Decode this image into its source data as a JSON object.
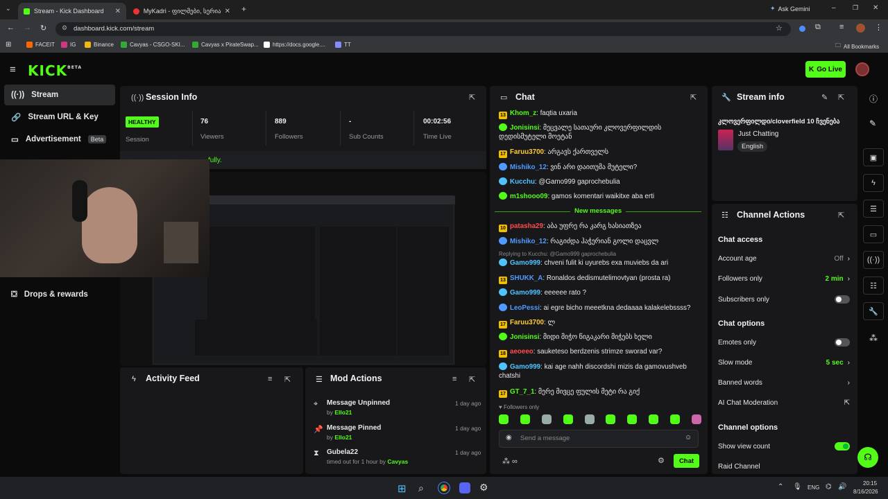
{
  "browser": {
    "tabs": [
      {
        "title": "Stream - Kick Dashboard"
      },
      {
        "title": "MyKadri - ფილმები, სერიალ"
      }
    ],
    "ask_gemini": "Ask Gemini",
    "url": "dashboard.kick.com/stream",
    "bookmarks": [
      "FACEIT",
      "IG",
      "Binance",
      "Cavyas - CSGO-SKI...",
      "Cavyas x PirateSwap...",
      "https://docs.google....",
      "TT"
    ],
    "all_bookmarks": "All Bookmarks"
  },
  "header": {
    "go_live": "Go Live"
  },
  "sidebar": {
    "items": [
      {
        "label": "Stream"
      },
      {
        "label": "Stream URL & Key"
      },
      {
        "label": "Advertisement"
      },
      {
        "label": "Drops & rewards"
      }
    ],
    "beta": "Beta"
  },
  "session": {
    "title": "Session Info",
    "status": "HEALTHY",
    "status_label": "Session",
    "stats": [
      {
        "value": "76",
        "label": "Viewers"
      },
      {
        "value": "889",
        "label": "Followers"
      },
      {
        "value": "-",
        "label": "Sub Counts"
      },
      {
        "value": "00:02:56",
        "label": "Time Live"
      }
    ],
    "notice": "fully."
  },
  "activity": {
    "title": "Activity Feed"
  },
  "mod_actions": {
    "title": "Mod Actions",
    "items": [
      {
        "action": "Message Unpinned",
        "by_prefix": "by",
        "by": "Ello21",
        "time": "1 day ago"
      },
      {
        "action": "Message Pinned",
        "by_prefix": "by",
        "by": "Ello21",
        "time": "1 day ago"
      },
      {
        "action": "Gubela22",
        "by_prefix": "timed out for 1 hour by",
        "by": "Cavyas",
        "time": "1 day ago"
      }
    ]
  },
  "chat": {
    "title": "Chat",
    "new_messages": "New messages",
    "replying": "Replying to Kucchu: @Gamo999 gaprochebulia",
    "followers_only": "Followers only",
    "input_placeholder": "Send a message",
    "send": "Chat",
    "colors": {
      "green": "#53fc18",
      "pink": "#ff4fd8",
      "blue": "#4f9bff",
      "red": "#ff4d4d"
    },
    "messages": [
      {
        "user": "Khom_z",
        "text": "faqtia uxaria",
        "color": "#53fc18",
        "badge": "13"
      },
      {
        "user": "Jonisinsi",
        "text": "მეცვალე სათაური კლოვერფილდის დედისმუტელი მოეტან",
        "color": "#53fc18",
        "badge": ""
      },
      {
        "user": "Faruu3700",
        "text": "არგავს ქართველს",
        "color": "#ffcc33",
        "badge": "17"
      },
      {
        "user": "Mishiko_12",
        "text": "ვინ არი დაითუმა მუტელი?",
        "color": "#4f9bff",
        "badge": ""
      },
      {
        "user": "Kucchu",
        "text": "@Gamo999 gaprochebulia",
        "color": "#4fc3ff",
        "badge": ""
      },
      {
        "user": "m1shooo09",
        "text": "gamos komentari waikitxe aba erti",
        "color": "#53fc18",
        "badge": ""
      },
      {
        "user": "patasha29",
        "text": "აბა უფრე რა კარგ ხასიათზეა",
        "color": "#ff4d4d",
        "badge": "10"
      },
      {
        "user": "Mishiko_12",
        "text": "რაგიძდა ჰაჭერიან გოლი დაცვლ",
        "color": "#4f9bff",
        "badge": ""
      },
      {
        "user": "Gamo999",
        "text": "chveni fulit ki uyurebs exa muviebs da ari",
        "color": "#4fc3ff",
        "badge": ""
      },
      {
        "user": "SHUKK_A",
        "text": "Ronaldos dedismutelimovtyan (prosta ra)",
        "color": "#4f9bff",
        "badge": "13"
      },
      {
        "user": "Gamo999",
        "text": "eeeeee rato ?",
        "color": "#4fc3ff",
        "badge": ""
      },
      {
        "user": "LeoPessi",
        "text": "ai egre bicho meeetkna dedaaaa kalakelebssss?",
        "color": "#4f9bff",
        "badge": ""
      },
      {
        "user": "Faruu3700",
        "text": "ლ",
        "color": "#ffcc33",
        "badge": "17"
      },
      {
        "user": "Jonisinsi",
        "text": "მიდი მიჭო წიგაკარი მიჭებს ხელი",
        "color": "#53fc18",
        "badge": ""
      },
      {
        "user": "aeoeeo",
        "text": "sauketeso berdzenis strimze sworad var?",
        "color": "#ff4d4d",
        "badge": "18"
      },
      {
        "user": "Gamo999",
        "text": "kai age nahh discordshi mizis da gamovushveb chatshi",
        "color": "#4fc3ff",
        "badge": ""
      },
      {
        "user": "GT_7_1",
        "text": "მერე მივცე ფულის მეტი რა გიქ",
        "color": "#53fc18",
        "badge": "17"
      }
    ]
  },
  "stream_info": {
    "title": "Stream info",
    "stream_title": "კლოვერფილდი/cloverfield 10 ჩვენება",
    "category": "Just Chatting",
    "language": "English"
  },
  "channel_actions": {
    "title": "Channel Actions",
    "chat_access": "Chat access",
    "account_age": {
      "label": "Account age",
      "value": "Off"
    },
    "followers_only": {
      "label": "Followers only",
      "value": "2 min"
    },
    "subscribers_only": {
      "label": "Subscribers only"
    },
    "chat_options": "Chat options",
    "emotes_only": {
      "label": "Emotes only"
    },
    "slow_mode": {
      "label": "Slow mode",
      "value": "5 sec"
    },
    "banned_words": {
      "label": "Banned words"
    },
    "ai_moderation": {
      "label": "AI Chat Moderation"
    },
    "channel_options": "Channel options",
    "show_view_count": {
      "label": "Show view count"
    },
    "raid_channel": {
      "label": "Raid Channel"
    }
  },
  "taskbar": {
    "lang": "ENG",
    "time": "20:15",
    "date": "8/16/2026"
  }
}
